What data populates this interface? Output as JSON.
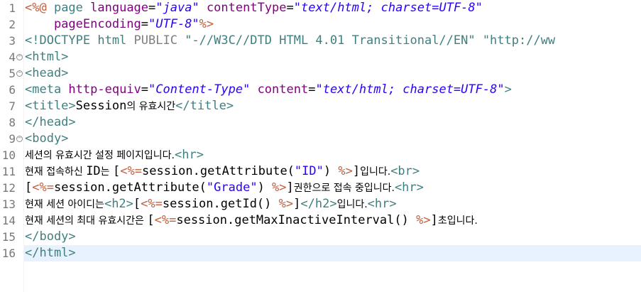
{
  "editor": {
    "lines": [
      {
        "n": "1",
        "fold": false,
        "tokens": [
          {
            "t": "<%@ ",
            "c": "delim"
          },
          {
            "t": "page ",
            "c": "tag"
          },
          {
            "t": "language",
            "c": "attr"
          },
          {
            "t": "=",
            "c": "plain"
          },
          {
            "t": "\"java\"",
            "c": "val"
          },
          {
            "t": " contentType",
            "c": "attr"
          },
          {
            "t": "=",
            "c": "plain"
          },
          {
            "t": "\"text/html; charset=UTF-8\"",
            "c": "val"
          }
        ]
      },
      {
        "n": "2",
        "fold": false,
        "tokens": [
          {
            "t": "    pageEncoding",
            "c": "attr"
          },
          {
            "t": "=",
            "c": "plain"
          },
          {
            "t": "\"UTF-8\"",
            "c": "val"
          },
          {
            "t": "%>",
            "c": "delim"
          }
        ]
      },
      {
        "n": "3",
        "fold": false,
        "tokens": [
          {
            "t": "<!DOCTYPE html ",
            "c": "tag"
          },
          {
            "t": "PUBLIC ",
            "c": "pub"
          },
          {
            "t": "\"-//W3C//DTD HTML 4.01 Transitional//EN\" \"http://ww",
            "c": "tag"
          }
        ]
      },
      {
        "n": "4",
        "fold": true,
        "tokens": [
          {
            "t": "<html>",
            "c": "tag"
          }
        ]
      },
      {
        "n": "5",
        "fold": true,
        "tokens": [
          {
            "t": "<head>",
            "c": "tag"
          }
        ]
      },
      {
        "n": "6",
        "fold": false,
        "tokens": [
          {
            "t": "<meta ",
            "c": "tag"
          },
          {
            "t": "http-equiv",
            "c": "attr"
          },
          {
            "t": "=",
            "c": "plain"
          },
          {
            "t": "\"Content-Type\"",
            "c": "val"
          },
          {
            "t": " content",
            "c": "attr"
          },
          {
            "t": "=",
            "c": "plain"
          },
          {
            "t": "\"text/html; charset=UTF-8\"",
            "c": "val"
          },
          {
            "t": ">",
            "c": "tag"
          }
        ]
      },
      {
        "n": "7",
        "fold": false,
        "tokens": [
          {
            "t": "<title>",
            "c": "tag"
          },
          {
            "t": "Session",
            "c": "plain"
          },
          {
            "t": "의 유효시간",
            "c": "korean"
          },
          {
            "t": "</title>",
            "c": "tag"
          }
        ]
      },
      {
        "n": "8",
        "fold": false,
        "tokens": [
          {
            "t": "</head>",
            "c": "tag"
          }
        ]
      },
      {
        "n": "9",
        "fold": true,
        "tokens": [
          {
            "t": "<body>",
            "c": "tag"
          }
        ]
      },
      {
        "n": "10",
        "fold": false,
        "tokens": [
          {
            "t": "세션의 유효시간 설정 페이지입니다.",
            "c": "korean"
          },
          {
            "t": "<hr>",
            "c": "tag"
          }
        ]
      },
      {
        "n": "11",
        "fold": false,
        "tokens": [
          {
            "t": "현재 접속하신 ",
            "c": "korean"
          },
          {
            "t": "ID",
            "c": "plain"
          },
          {
            "t": "는 ",
            "c": "korean"
          },
          {
            "t": "[",
            "c": "plain"
          },
          {
            "t": "<%=",
            "c": "delim"
          },
          {
            "t": "session.getAttribute(",
            "c": "plain"
          },
          {
            "t": "\"ID\"",
            "c": "str"
          },
          {
            "t": ") ",
            "c": "plain"
          },
          {
            "t": "%>",
            "c": "delim"
          },
          {
            "t": "]",
            "c": "plain"
          },
          {
            "t": "입니다.",
            "c": "korean"
          },
          {
            "t": "<br>",
            "c": "tag"
          }
        ]
      },
      {
        "n": "12",
        "fold": false,
        "tokens": [
          {
            "t": "[",
            "c": "plain"
          },
          {
            "t": "<%=",
            "c": "delim"
          },
          {
            "t": "session.getAttribute(",
            "c": "plain"
          },
          {
            "t": "\"Grade\"",
            "c": "str"
          },
          {
            "t": ") ",
            "c": "plain"
          },
          {
            "t": "%>",
            "c": "delim"
          },
          {
            "t": "]",
            "c": "plain"
          },
          {
            "t": "권한으로 접속 중입니다.",
            "c": "korean"
          },
          {
            "t": "<hr>",
            "c": "tag"
          }
        ]
      },
      {
        "n": "13",
        "fold": false,
        "tokens": [
          {
            "t": "현재 세션 아이디는",
            "c": "korean"
          },
          {
            "t": "<h2>",
            "c": "tag"
          },
          {
            "t": "[",
            "c": "plain"
          },
          {
            "t": "<%=",
            "c": "delim"
          },
          {
            "t": "session.getId() ",
            "c": "plain"
          },
          {
            "t": "%>",
            "c": "delim"
          },
          {
            "t": "]",
            "c": "plain"
          },
          {
            "t": "</h2>",
            "c": "tag"
          },
          {
            "t": "입니다.",
            "c": "korean"
          },
          {
            "t": "<hr>",
            "c": "tag"
          }
        ]
      },
      {
        "n": "14",
        "fold": false,
        "tokens": [
          {
            "t": "현재 세션의 최대 유효시간은 ",
            "c": "korean"
          },
          {
            "t": "[",
            "c": "plain"
          },
          {
            "t": "<%=",
            "c": "delim"
          },
          {
            "t": "session.getMaxInactiveInterval() ",
            "c": "plain"
          },
          {
            "t": "%>",
            "c": "delim"
          },
          {
            "t": "]",
            "c": "plain"
          },
          {
            "t": "초입니다.",
            "c": "korean"
          }
        ]
      },
      {
        "n": "15",
        "fold": false,
        "tokens": [
          {
            "t": "</body>",
            "c": "tag"
          }
        ]
      },
      {
        "n": "16",
        "fold": false,
        "current": true,
        "tokens": [
          {
            "t": "</html>",
            "c": "tag"
          }
        ]
      }
    ]
  }
}
